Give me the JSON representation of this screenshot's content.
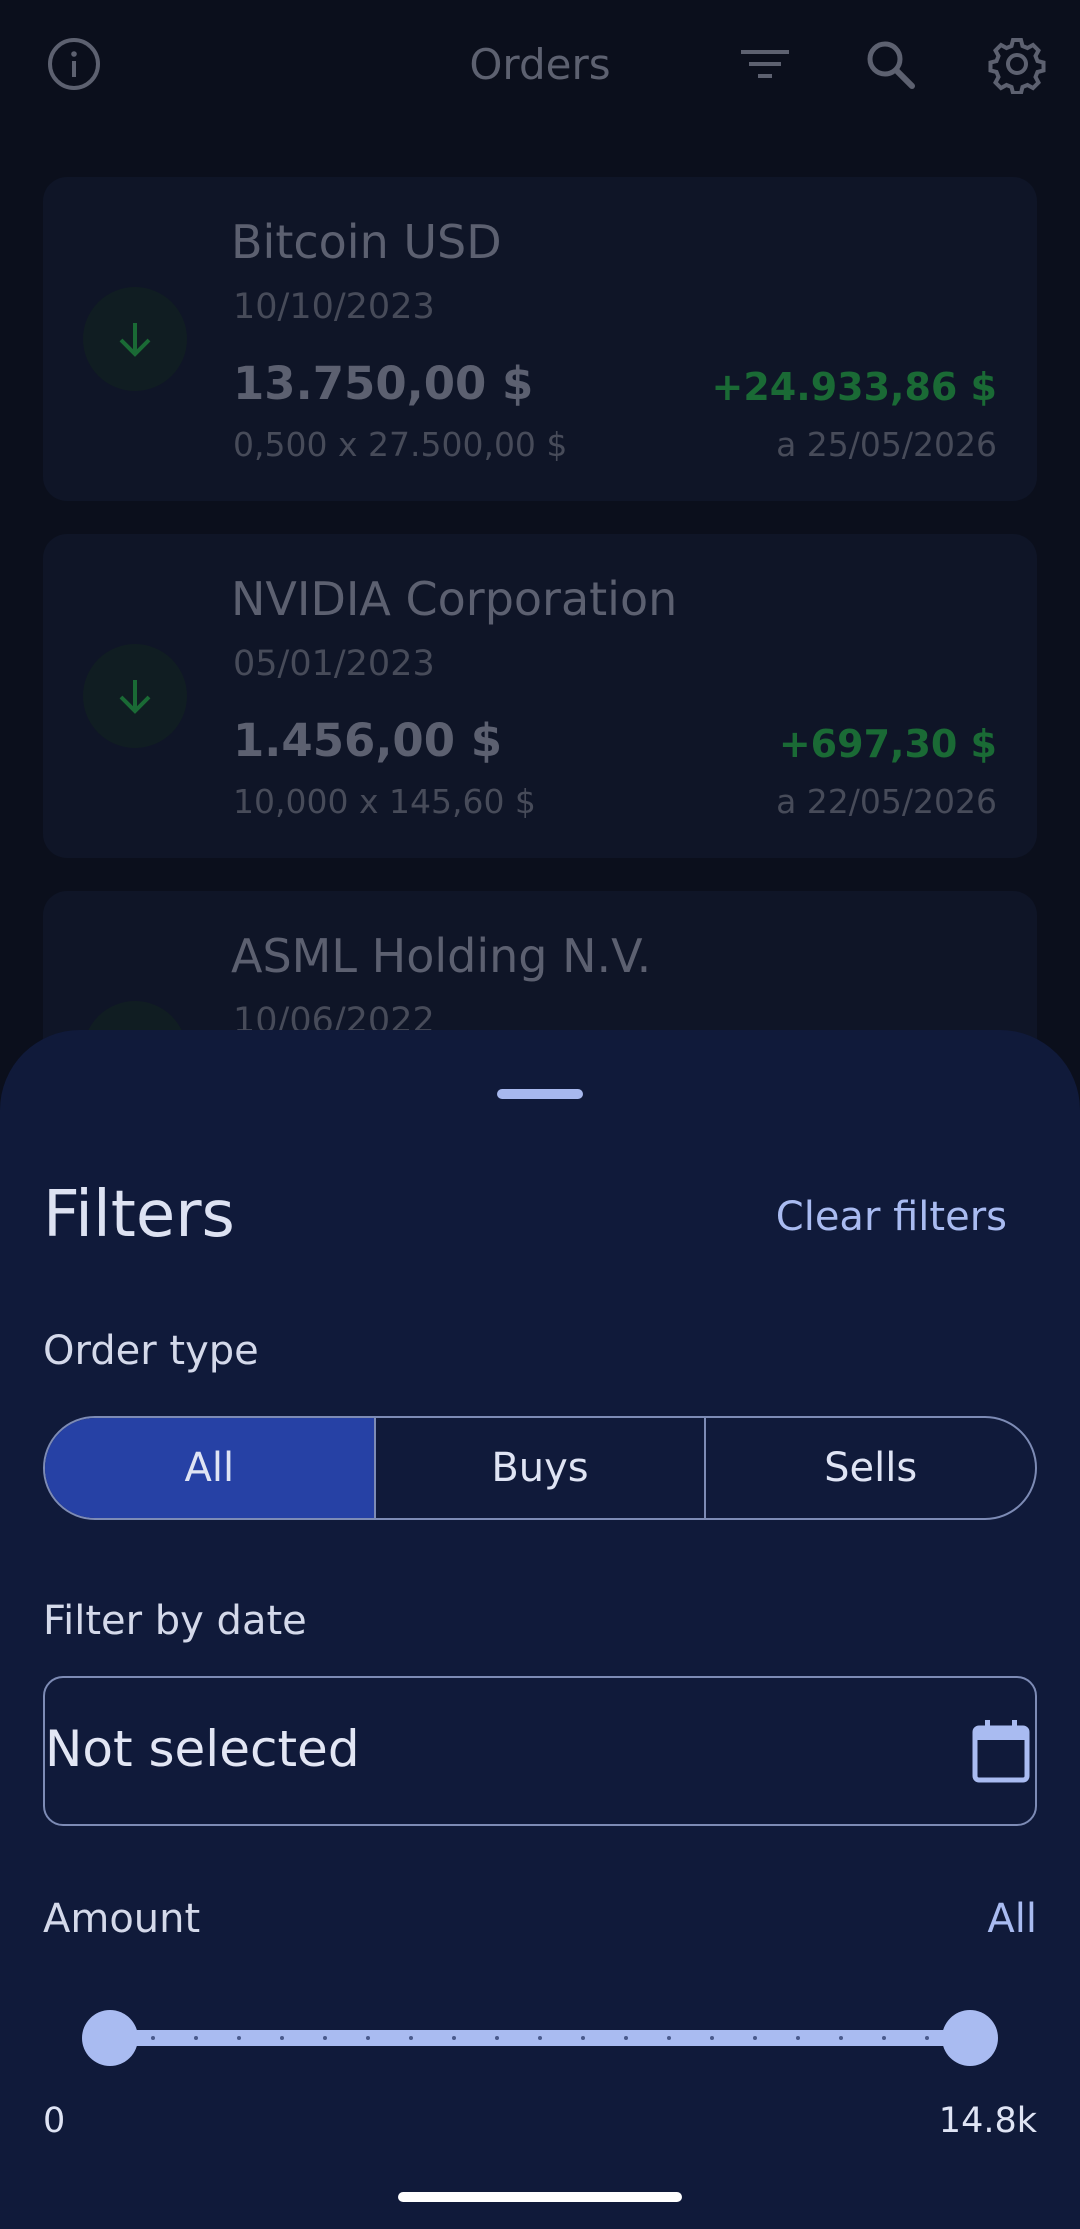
{
  "header": {
    "title": "Orders"
  },
  "orders": [
    {
      "name": "Bitcoin USD",
      "date": "10/10/2023",
      "total": "13.750,00 $",
      "detail": "0,500 x 27.500,00 $",
      "gain": "+24.933,86 $",
      "as_of": "a 25/05/2026"
    },
    {
      "name": "NVIDIA Corporation",
      "date": "05/01/2023",
      "total": "1.456,00 $",
      "detail": "10,000 x 145,60 $",
      "gain": "+697,30 $",
      "as_of": "a 22/05/2026"
    },
    {
      "name": "ASML Holding N.V.",
      "date": "10/06/2022"
    }
  ],
  "filters": {
    "title": "Filters",
    "clear_label": "Clear filters",
    "order_type_label": "Order type",
    "order_type_options": [
      "All",
      "Buys",
      "Sells"
    ],
    "order_type_selected": "All",
    "date_label": "Filter by date",
    "date_value": "Not selected",
    "amount_label": "Amount",
    "amount_value": "All",
    "amount_min_label": "0",
    "amount_max_label": "14.8k",
    "amount_range_fraction": [
      0,
      1
    ]
  },
  "colors": {
    "sheet_bg": "#101a3a",
    "accent": "#a9bbf1",
    "selected_segment": "#2641a5",
    "gain_green": "#1a6a35"
  },
  "icons": [
    "info-icon",
    "filter-icon",
    "search-icon",
    "gear-icon",
    "arrow-down-icon",
    "calendar-icon"
  ]
}
